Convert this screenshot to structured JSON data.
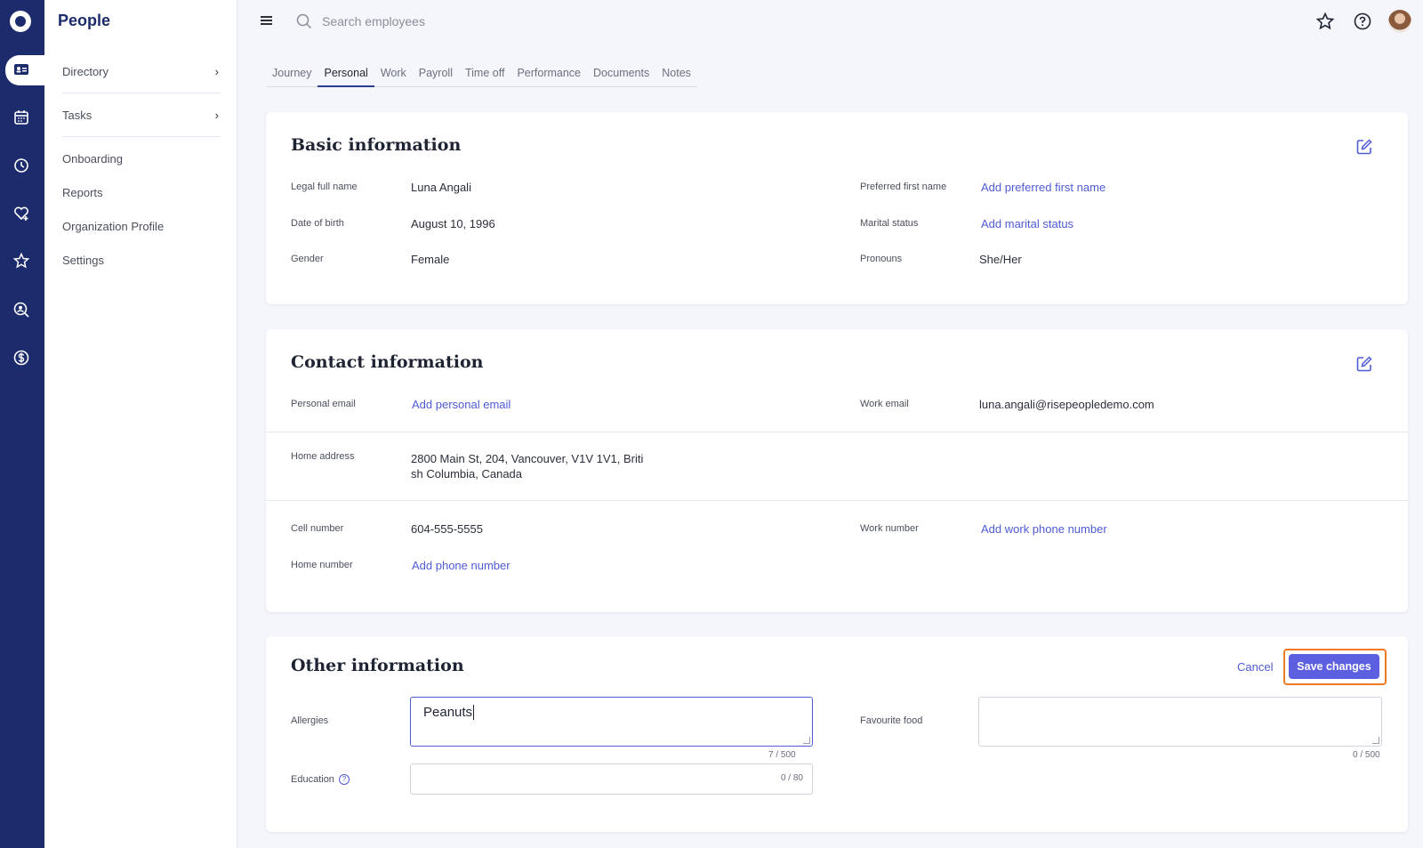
{
  "app": {
    "section_title": "People"
  },
  "rail": {
    "items": [
      "logo",
      "id-card-icon",
      "calendar-icon",
      "clock-icon",
      "heart-plus-icon",
      "star-icon",
      "search-person-icon",
      "dollar-icon"
    ]
  },
  "sidebar": {
    "items": [
      {
        "label": "Directory",
        "has_chevron": true
      },
      {
        "label": "Tasks",
        "has_chevron": true
      },
      {
        "label": "Onboarding"
      },
      {
        "label": "Reports"
      },
      {
        "label": "Organization Profile"
      },
      {
        "label": "Settings"
      }
    ]
  },
  "topbar": {
    "search_placeholder": "Search employees"
  },
  "tabs": [
    {
      "label": "Journey"
    },
    {
      "label": "Personal",
      "active": true
    },
    {
      "label": "Work"
    },
    {
      "label": "Payroll"
    },
    {
      "label": "Time off"
    },
    {
      "label": "Performance"
    },
    {
      "label": "Documents"
    },
    {
      "label": "Notes"
    }
  ],
  "basic": {
    "title": "Basic information",
    "legal_name_label": "Legal full name",
    "legal_name": "Luna Angali",
    "dob_label": "Date of birth",
    "dob": "August 10, 1996",
    "gender_label": "Gender",
    "gender": "Female",
    "preferred_label": "Preferred first name",
    "preferred_link": "Add preferred first name",
    "marital_label": "Marital status",
    "marital_link": "Add marital status",
    "pronouns_label": "Pronouns",
    "pronouns": "She/Her"
  },
  "contact": {
    "title": "Contact information",
    "personal_email_label": "Personal email",
    "personal_email_link": "Add personal email",
    "work_email_label": "Work email",
    "work_email": "luna.angali@risepeopledemo.com",
    "home_address_label": "Home address",
    "home_address_line1": "2800 Main St, 204, Vancouver, V1V 1V1, Briti",
    "home_address_line2": "sh Columbia, Canada",
    "cell_label": "Cell number",
    "cell": "604-555-5555",
    "work_number_label": "Work number",
    "work_number_link": "Add work phone number",
    "home_number_label": "Home number",
    "home_number_link": "Add phone number"
  },
  "other": {
    "title": "Other information",
    "cancel_label": "Cancel",
    "save_label": "Save changes",
    "allergies_label": "Allergies",
    "allergies_value": "Peanuts",
    "allergies_counter": "7 / 500",
    "favourite_food_label": "Favourite food",
    "favourite_food_value": "",
    "favourite_food_counter": "0 / 500",
    "education_label": "Education",
    "education_counter": "0 / 80",
    "education_help": "?"
  },
  "colors": {
    "rail": "#1c2b6b",
    "accent": "#5c5fe0",
    "link": "#4f5bd5",
    "highlight": "#f07a22"
  }
}
